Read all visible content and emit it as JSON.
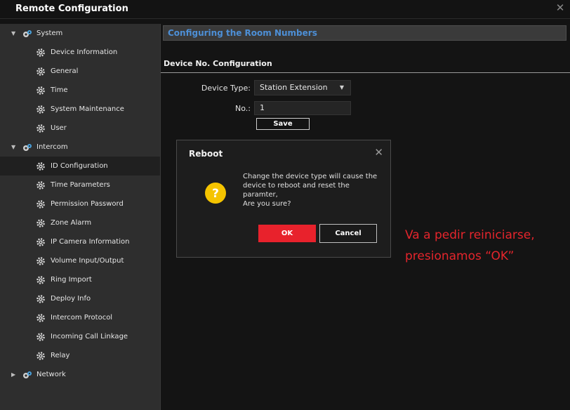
{
  "window": {
    "title": "Remote Configuration",
    "close_icon": "close-icon"
  },
  "sidebar": {
    "groups": [
      {
        "label": "System",
        "expanded": true
      },
      {
        "label": "Intercom",
        "expanded": true
      },
      {
        "label": "Network",
        "expanded": false
      }
    ],
    "system_items": [
      "Device Information",
      "General",
      "Time",
      "System Maintenance",
      "User"
    ],
    "intercom_items": [
      "ID Configuration",
      "Time Parameters",
      "Permission Password",
      "Zone Alarm",
      "IP Camera Information",
      "Volume Input/Output",
      "Ring Import",
      "Deploy Info",
      "Intercom Protocol",
      "Incoming Call Linkage",
      "Relay"
    ],
    "selected": "ID Configuration"
  },
  "main": {
    "section_title": "Configuring the Room Numbers",
    "subsection_title": "Device No. Configuration",
    "device_type_label": "Device Type:",
    "device_type_value": "Station Extension",
    "no_label": "No.:",
    "no_value": "1",
    "save_label": "Save"
  },
  "dialog": {
    "title": "Reboot",
    "message_lines": [
      "Change the device type will cause the",
      "device to reboot and reset the",
      "paramter,",
      "Are you sure?"
    ],
    "ok_label": "OK",
    "cancel_label": "Cancel"
  },
  "annotation": {
    "lines": [
      "Va a pedir reiniciarse,",
      "presionamos “OK”"
    ]
  },
  "colors": {
    "accent_blue": "#4d8fd6",
    "ok_red": "#e8222c",
    "annotation_red": "#e5252c",
    "warning_yellow": "#f5c400"
  }
}
